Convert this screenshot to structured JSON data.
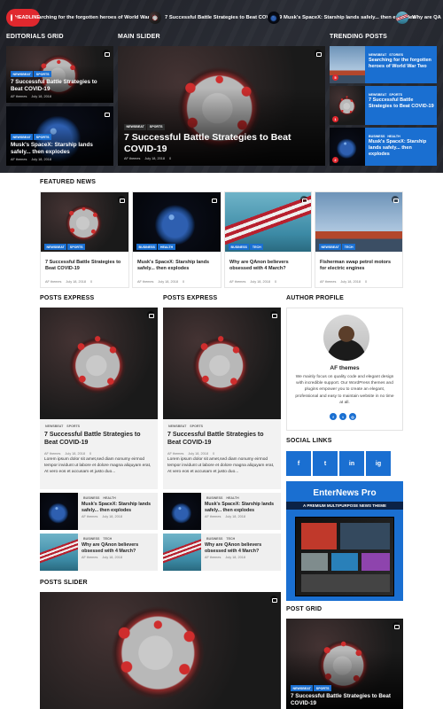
{
  "ticker": {
    "label": "HEADLINE",
    "items": [
      "earching for the forgotten heroes of World War Two",
      "7 Successful Battle Strategies to Beat COVID-19",
      "Musk's SpaceX: Starship lands safely... then explodes",
      "Why are QA"
    ]
  },
  "sections": {
    "editorials": "EDITORIALS GRID",
    "main_slider": "MAIN SLIDER",
    "trending": "TRENDING POSTS",
    "featured": "FEATURED NEWS",
    "posts_express_1": "POSTS EXPRESS",
    "posts_express_2": "POSTS EXPRESS",
    "author": "AUTHOR PROFILE",
    "social": "SOCIAL LINKS",
    "posts_slider": "POSTS SLIDER",
    "post_grid": "POST GRID"
  },
  "common": {
    "author": "AF themes",
    "date": "July 18, 2018",
    "comments": "0"
  },
  "editorials": [
    {
      "badges": [
        "NEWSBEAT",
        "SPORTS"
      ],
      "title": "7 Successful Battle Strategies to Beat COVID-19"
    },
    {
      "badges": [
        "NEWSBEAT",
        "SPORTS"
      ],
      "title": "Musk's SpaceX: Starship lands safely... then explodes"
    }
  ],
  "main_slide": {
    "badges": [
      "NEWSBEAT",
      "SPORTS"
    ],
    "title": "7 Successful Battle Strategies to Beat COVID-19"
  },
  "trending": [
    {
      "num": "5",
      "badges": [
        "NEWSBEAT",
        "STORIES"
      ],
      "title": "Searching for the forgotten heroes of World War Two"
    },
    {
      "num": "1",
      "badges": [
        "NEWSBEAT",
        "SPORTS"
      ],
      "title": "7 Successful Battle Strategies to Beat COVID-19"
    },
    {
      "num": "2",
      "badges": [
        "BUSINESS",
        "HEALTH"
      ],
      "title": "Musk's SpaceX: Starship lands safely... then explodes"
    }
  ],
  "featured": [
    {
      "badges": [
        "NEWSBEAT",
        "SPORTS"
      ],
      "title": "7 Successful Battle Strategies to Beat COVID-19"
    },
    {
      "badges": [
        "BUSINESS",
        "HEALTH"
      ],
      "title": "Musk's SpaceX: Starship lands safely... then explodes"
    },
    {
      "badges": [
        "BUSINESS",
        "TECH"
      ],
      "title": "Why are QAnon believers obsessed with 4 March?"
    },
    {
      "badges": [
        "NEWSBEAT",
        "TECH"
      ],
      "title": "Fisherman swap petrol motors for electric engines"
    }
  ],
  "express": [
    {
      "badges": [
        "NEWSBEAT",
        "SPORTS"
      ],
      "title": "7 Successful Battle Strategies to Beat COVID-19",
      "excerpt": "Lorem ipsum dolor sit amet,sed diam nonumy eirmod tempor invidunt ut labore et dolore magna aliquyam erat, At vero eos et accusam et justo duo...",
      "list": [
        {
          "badges": [
            "BUSINESS",
            "HEALTH"
          ],
          "title": "Musk's SpaceX: Starship lands safely... then explodes"
        },
        {
          "badges": [
            "BUSINESS",
            "TECH"
          ],
          "title": "Why are QAnon believers obsessed with 4 March?"
        }
      ]
    },
    {
      "badges": [
        "NEWSBEAT",
        "SPORTS"
      ],
      "title": "7 Successful Battle Strategies to Beat COVID-19",
      "excerpt": "Lorem ipsum dolor sit amet,sed diam nonumy eirmod tempor invidunt ut labore et dolore magna aliquyam erat, At vero eos et accusam et justo duo...",
      "list": [
        {
          "badges": [
            "BUSINESS",
            "HEALTH"
          ],
          "title": "Musk's SpaceX: Starship lands safely... then explodes"
        },
        {
          "badges": [
            "BUSINESS",
            "TECH"
          ],
          "title": "Why are QAnon believers obsessed with 4 March?"
        }
      ]
    }
  ],
  "author": {
    "name": "AF themes",
    "bio": "We mainly focus on quality code and elegant design with incredible support. Our WordPress themes and plugins empower you to create an elegant, professional and easy to maintain website in no time at all."
  },
  "social": [
    "f",
    "t",
    "in",
    "ig"
  ],
  "promo": {
    "title": "EnterNews Pro",
    "subtitle": "A PREMIUM MULTIPURPOSE NEWS THEME"
  },
  "post_grid": {
    "badges": [
      "NEWSBEAT",
      "SPORTS"
    ],
    "title": "7 Successful Battle Strategies to Beat COVID-19"
  },
  "colors": {
    "accent": "#1a6fd1",
    "headline": "#e0282e",
    "band": "#24262d"
  }
}
